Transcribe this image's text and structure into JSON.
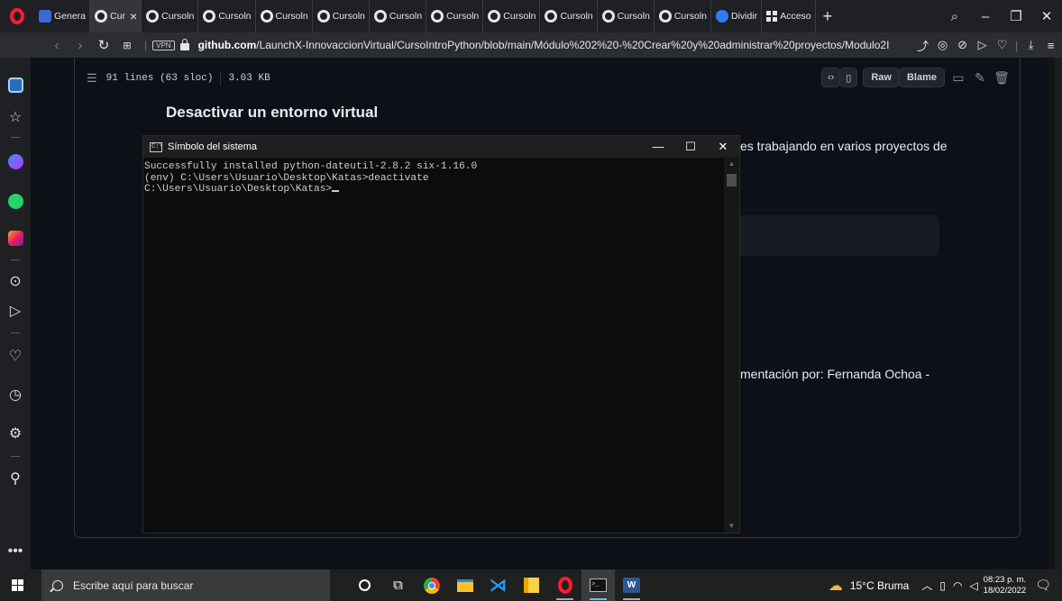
{
  "browser": {
    "tabs": [
      {
        "label": "Genera",
        "icon": "tdash",
        "active": false
      },
      {
        "label": "Cur",
        "icon": "gh",
        "active": true
      },
      {
        "label": "Cursoln",
        "icon": "gh",
        "active": false
      },
      {
        "label": "Cursoln",
        "icon": "gh",
        "active": false
      },
      {
        "label": "Cursoln",
        "icon": "gh",
        "active": false
      },
      {
        "label": "Cursoln",
        "icon": "gh",
        "active": false
      },
      {
        "label": "Cursoln",
        "icon": "gh",
        "active": false
      },
      {
        "label": "Cursoln",
        "icon": "gh",
        "active": false
      },
      {
        "label": "Cursoln",
        "icon": "gh",
        "active": false
      },
      {
        "label": "Cursoln",
        "icon": "gh",
        "active": false
      },
      {
        "label": "Cursoln",
        "icon": "gh",
        "active": false
      },
      {
        "label": "Cursoln",
        "icon": "gh",
        "active": false
      },
      {
        "label": "Dividir",
        "icon": "tblue",
        "active": false
      },
      {
        "label": "Acceso",
        "icon": "grid",
        "active": false
      }
    ],
    "new_tab": "+",
    "address": {
      "vpn": "VPN",
      "domain": "github.com",
      "path": "/LaunchX-InnovaccionVirtual/CursoIntroPython/blob/main/Módulo%202%20-%20Crear%20y%20administrar%20proyectos/Modulo2I"
    }
  },
  "github": {
    "file_info": {
      "lines": "91 lines (63 sloc)",
      "size": "3.03 KB",
      "raw": "Raw",
      "blame": "Blame"
    },
    "heading": "Desactivar un entorno virtual",
    "text_line1": "es trabajando en varios proyectos de",
    "text_line2": "mentación por: Fernanda Ochoa -"
  },
  "cmd": {
    "title": "Símbolo del sistema",
    "lines": [
      "Successfully installed python-dateutil-2.8.2 six-1.16.0",
      "",
      "(env) C:\\Users\\Usuario\\Desktop\\Katas>deactivate",
      "C:\\Users\\Usuario\\Desktop\\Katas>"
    ]
  },
  "taskbar": {
    "search_placeholder": "Escribe aquí para buscar",
    "weather": "15°C  Bruma",
    "time": "08:23 p. m.",
    "date": "18/02/2022"
  }
}
